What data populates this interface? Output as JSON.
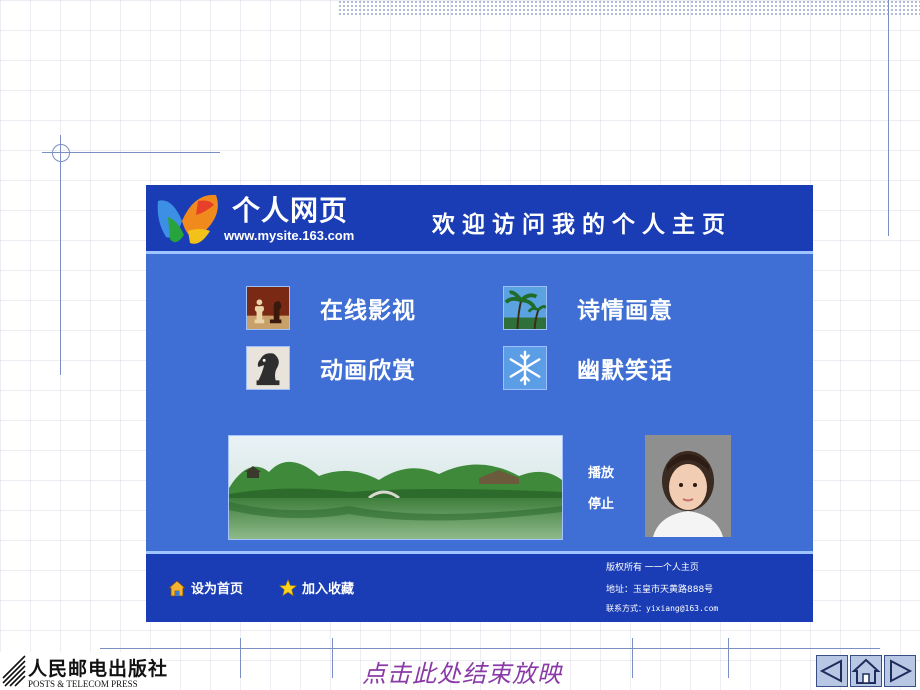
{
  "site": {
    "logo": {
      "title": "个人网页",
      "url": "www.mysite.163.com"
    },
    "welcome": "欢迎访问我的个人主页",
    "menu": [
      {
        "label": "在线影视",
        "icon": "chess-icon"
      },
      {
        "label": "诗情画意",
        "icon": "palm-tree-icon"
      },
      {
        "label": "动画欣赏",
        "icon": "horse-chess-icon"
      },
      {
        "label": "幽默笑话",
        "icon": "snowflake-icon"
      }
    ],
    "media": {
      "play_label": "播放",
      "stop_label": "停止"
    },
    "footer": {
      "set_home_label": "设为首页",
      "add_favorite_label": "加入收藏",
      "copyright": "版权所有  一一个人主页",
      "address": "地址：玉皇市天黄路888号",
      "contact": "联系方式：yixiang@163.com"
    }
  },
  "slide": {
    "publisher_cn": "人民邮电出版社",
    "publisher_en": "POSTS & TELECOM PRESS",
    "end_show": "点击此处结束放映"
  },
  "colors": {
    "header_blue": "#1a3db5",
    "body_blue": "#3f6fd4",
    "accent_line": "#9fc4ff",
    "end_show_text": "#8a3aa6"
  }
}
